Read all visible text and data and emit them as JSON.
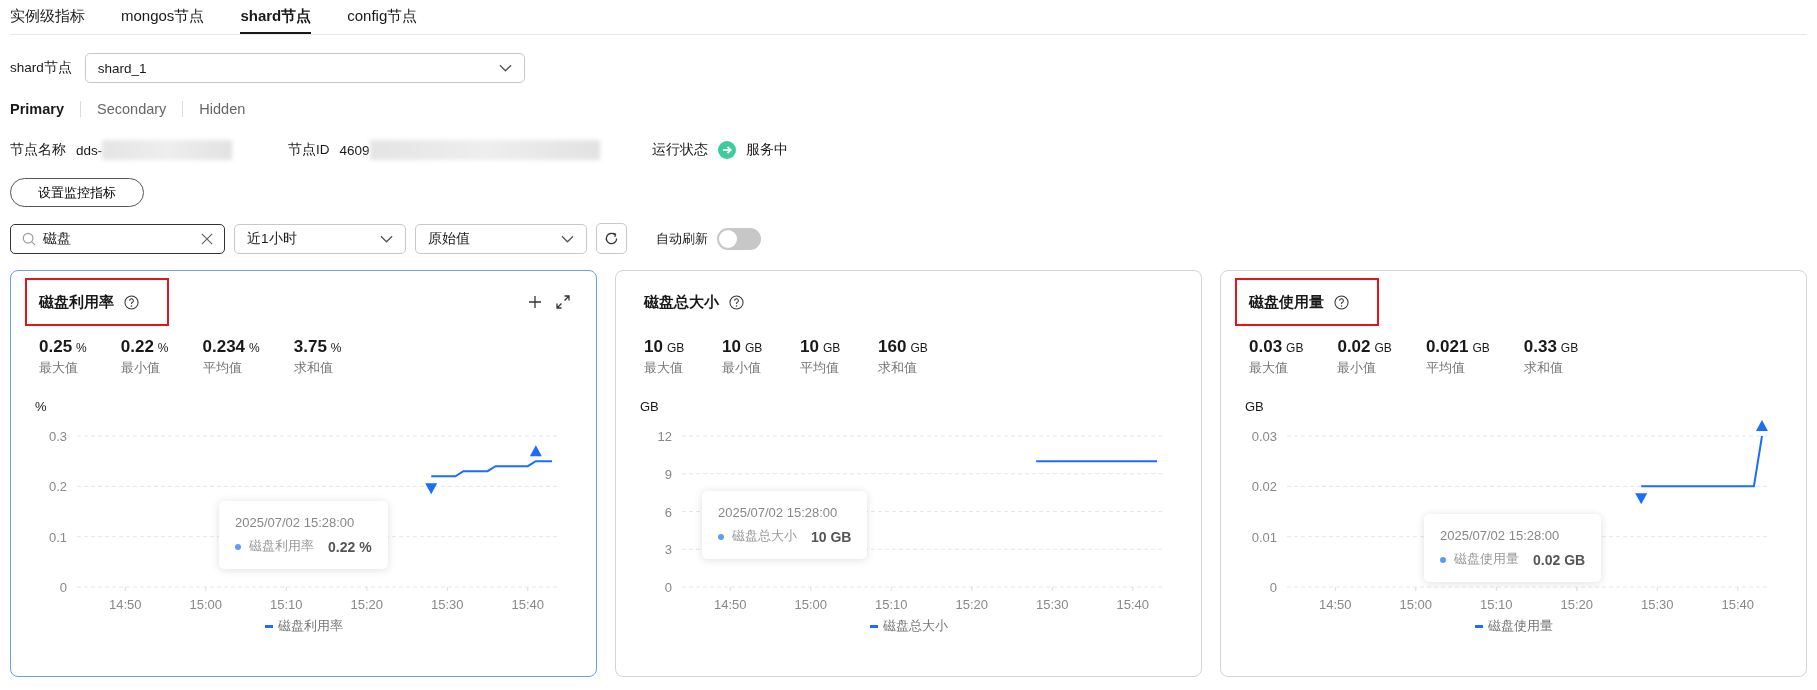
{
  "tabs": [
    {
      "label": "实例级指标",
      "selected": false
    },
    {
      "label": "mongos节点",
      "selected": false
    },
    {
      "label": "shard节点",
      "selected": true
    },
    {
      "label": "config节点",
      "selected": false
    }
  ],
  "node_select": {
    "label": "shard节点",
    "value": "shard_1"
  },
  "role_tabs": [
    {
      "label": "Primary",
      "selected": true
    },
    {
      "label": "Secondary",
      "selected": false
    },
    {
      "label": "Hidden",
      "selected": false
    }
  ],
  "node_info": [
    {
      "kind": "text",
      "label": "节点名称",
      "value": "dds-",
      "redacted": true
    },
    {
      "kind": "text",
      "label": "节点ID",
      "value": "4609",
      "redacted": true
    },
    {
      "kind": "status",
      "label": "运行状态",
      "value": "服务中",
      "redacted": false
    }
  ],
  "set_metrics_button": "设置监控指标",
  "filters": {
    "search": {
      "value": "磁盘"
    },
    "period": "近1小时",
    "value_type": "原始值",
    "auto_refresh": {
      "label": "自动刷新",
      "on": false
    }
  },
  "charts": [
    {
      "title": "磁盘利用率",
      "selected": true,
      "highlighted": true,
      "stats": [
        {
          "value": "0.25",
          "unit": "%",
          "label": "最大值"
        },
        {
          "value": "0.22",
          "unit": "%",
          "label": "最小值"
        },
        {
          "value": "0.234",
          "unit": "%",
          "label": "平均值"
        },
        {
          "value": "3.75",
          "unit": "%",
          "label": "求和值"
        }
      ],
      "tooltip": {
        "time": "2025/07/02 15:28:00",
        "series": "磁盘利用率",
        "value": "0.22 %"
      },
      "chart_data": {
        "type": "line",
        "ylabel": "%",
        "categories": [
          null,
          null,
          null,
          null,
          null,
          null,
          "14:50",
          null,
          null,
          null,
          null,
          null,
          null,
          null,
          null,
          null,
          "15:00",
          null,
          null,
          null,
          null,
          null,
          null,
          null,
          null,
          null,
          "15:10",
          null,
          null,
          null,
          null,
          null,
          null,
          null,
          null,
          null,
          "15:20",
          null,
          null,
          null,
          null,
          null,
          null,
          null,
          null,
          null,
          "15:30",
          null,
          null,
          null,
          null,
          null,
          null,
          null,
          null,
          null,
          "15:40",
          null,
          null,
          null,
          null
        ],
        "series": [
          {
            "name": "磁盘利用率",
            "color": "#1a6dff",
            "values": [
              null,
              null,
              null,
              null,
              null,
              null,
              null,
              null,
              null,
              null,
              null,
              null,
              null,
              null,
              null,
              null,
              null,
              null,
              null,
              null,
              null,
              null,
              null,
              null,
              null,
              null,
              null,
              null,
              null,
              null,
              null,
              null,
              null,
              null,
              null,
              null,
              null,
              null,
              null,
              null,
              null,
              null,
              null,
              null,
              0.22,
              0.22,
              0.22,
              0.22,
              0.23,
              0.23,
              0.23,
              0.23,
              0.24,
              0.24,
              0.24,
              0.24,
              0.24,
              0.25,
              0.25,
              0.25,
              null
            ]
          }
        ],
        "grid": true,
        "ylim": [
          0,
          0.3
        ],
        "yticks": [
          0,
          0.1,
          0.2,
          0.3
        ]
      }
    },
    {
      "title": "磁盘总大小",
      "selected": false,
      "highlighted": false,
      "stats": [
        {
          "value": "10",
          "unit": "GB",
          "label": "最大值"
        },
        {
          "value": "10",
          "unit": "GB",
          "label": "最小值"
        },
        {
          "value": "10",
          "unit": "GB",
          "label": "平均值"
        },
        {
          "value": "160",
          "unit": "GB",
          "label": "求和值"
        }
      ],
      "tooltip": {
        "time": "2025/07/02 15:28:00",
        "series": "磁盘总大小",
        "value": "10 GB"
      },
      "chart_data": {
        "type": "line",
        "ylabel": "GB",
        "categories": [
          null,
          null,
          null,
          null,
          null,
          null,
          "14:50",
          null,
          null,
          null,
          null,
          null,
          null,
          null,
          null,
          null,
          "15:00",
          null,
          null,
          null,
          null,
          null,
          null,
          null,
          null,
          null,
          "15:10",
          null,
          null,
          null,
          null,
          null,
          null,
          null,
          null,
          null,
          "15:20",
          null,
          null,
          null,
          null,
          null,
          null,
          null,
          null,
          null,
          "15:30",
          null,
          null,
          null,
          null,
          null,
          null,
          null,
          null,
          null,
          "15:40",
          null,
          null,
          null,
          null
        ],
        "series": [
          {
            "name": "磁盘总大小",
            "color": "#1a6dff",
            "values": [
              null,
              null,
              null,
              null,
              null,
              null,
              null,
              null,
              null,
              null,
              null,
              null,
              null,
              null,
              null,
              null,
              null,
              null,
              null,
              null,
              null,
              null,
              null,
              null,
              null,
              null,
              null,
              null,
              null,
              null,
              null,
              null,
              null,
              null,
              null,
              null,
              null,
              null,
              null,
              null,
              null,
              null,
              null,
              null,
              10,
              10,
              10,
              10,
              10,
              10,
              10,
              10,
              10,
              10,
              10,
              10,
              10,
              10,
              10,
              10,
              null
            ]
          }
        ],
        "grid": true,
        "ylim": [
          0,
          12
        ],
        "yticks": [
          0,
          3,
          6,
          9,
          12
        ]
      }
    },
    {
      "title": "磁盘使用量",
      "selected": false,
      "highlighted": true,
      "stats": [
        {
          "value": "0.03",
          "unit": "GB",
          "label": "最大值"
        },
        {
          "value": "0.02",
          "unit": "GB",
          "label": "最小值"
        },
        {
          "value": "0.021",
          "unit": "GB",
          "label": "平均值"
        },
        {
          "value": "0.33",
          "unit": "GB",
          "label": "求和值"
        }
      ],
      "tooltip": {
        "time": "2025/07/02 15:28:00",
        "series": "磁盘使用量",
        "value": "0.02 GB"
      },
      "chart_data": {
        "type": "line",
        "ylabel": "GB",
        "categories": [
          null,
          null,
          null,
          null,
          null,
          null,
          "14:50",
          null,
          null,
          null,
          null,
          null,
          null,
          null,
          null,
          null,
          "15:00",
          null,
          null,
          null,
          null,
          null,
          null,
          null,
          null,
          null,
          "15:10",
          null,
          null,
          null,
          null,
          null,
          null,
          null,
          null,
          null,
          "15:20",
          null,
          null,
          null,
          null,
          null,
          null,
          null,
          null,
          null,
          "15:30",
          null,
          null,
          null,
          null,
          null,
          null,
          null,
          null,
          null,
          "15:40",
          null,
          null,
          null,
          null
        ],
        "series": [
          {
            "name": "磁盘使用量",
            "color": "#1a6dff",
            "values": [
              null,
              null,
              null,
              null,
              null,
              null,
              null,
              null,
              null,
              null,
              null,
              null,
              null,
              null,
              null,
              null,
              null,
              null,
              null,
              null,
              null,
              null,
              null,
              null,
              null,
              null,
              null,
              null,
              null,
              null,
              null,
              null,
              null,
              null,
              null,
              null,
              null,
              null,
              null,
              null,
              null,
              null,
              null,
              null,
              0.02,
              0.02,
              0.02,
              0.02,
              0.02,
              0.02,
              0.02,
              0.02,
              0.02,
              0.02,
              0.02,
              0.02,
              0.02,
              0.02,
              0.02,
              0.03,
              null
            ]
          }
        ],
        "grid": true,
        "ylim": [
          0,
          0.03
        ],
        "yticks": [
          0,
          0.01,
          0.02,
          0.03
        ]
      }
    }
  ]
}
